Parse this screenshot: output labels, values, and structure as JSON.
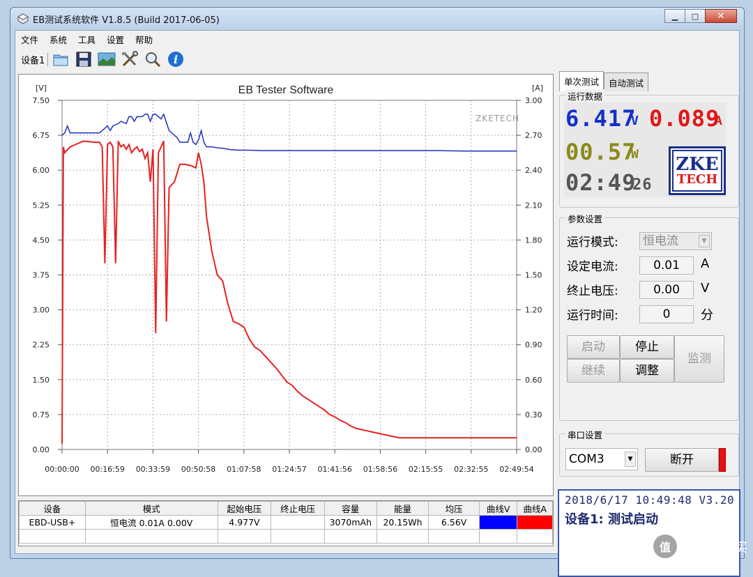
{
  "window": {
    "title": "EB测试系统软件 V1.8.5 (Build 2017-06-05)",
    "controls": {
      "minimize": "▁",
      "maximize": "□",
      "close": "✕"
    }
  },
  "menu": [
    "文件",
    "系统",
    "工具",
    "设置",
    "帮助"
  ],
  "toolbar": {
    "device": "设备1",
    "icons": [
      "folder-open-icon",
      "save-icon",
      "chart-image-icon",
      "tools-icon",
      "search-icon",
      "info-icon"
    ],
    "info_glyph": "i"
  },
  "chart": {
    "title": "EB Tester Software",
    "watermark": "ZKETECH",
    "left_unit": "[V]",
    "right_unit": "[A]"
  },
  "chart_data": {
    "type": "line",
    "title": "EB Tester Software",
    "x_ticks": [
      "00:00:00",
      "00:16:59",
      "00:33:59",
      "00:50:58",
      "01:07:58",
      "01:24:57",
      "01:41:56",
      "01:58:56",
      "02:15:55",
      "02:32:55",
      "02:49:54"
    ],
    "x_range_seconds": [
      0,
      10194
    ],
    "y_left": {
      "label": "[V]",
      "range": [
        0,
        7.5
      ],
      "ticks": [
        "7.50",
        "6.75",
        "6.00",
        "5.25",
        "4.50",
        "3.75",
        "3.00",
        "2.25",
        "1.50",
        "0.75",
        "0.00"
      ]
    },
    "y_right": {
      "label": "[A]",
      "range": [
        0,
        3.0
      ],
      "ticks": [
        "3.00",
        "2.70",
        "2.40",
        "2.10",
        "1.80",
        "1.50",
        "1.20",
        "0.90",
        "0.60",
        "0.30",
        "0.00"
      ]
    },
    "grid": true,
    "series": [
      {
        "color": "#1f2fbf",
        "axis": "left",
        "x_minutes": [
          0,
          1,
          2,
          3,
          8,
          14,
          17,
          18,
          19,
          21,
          22,
          24,
          25,
          26,
          27,
          28,
          30,
          31,
          32,
          33,
          34,
          35,
          37,
          38,
          40,
          43,
          44,
          45,
          46,
          47,
          48,
          49,
          50,
          51,
          52,
          53,
          54,
          56,
          58,
          60,
          63,
          66,
          70,
          75,
          80,
          90,
          100,
          110,
          120,
          130,
          140,
          150,
          160,
          170
        ],
        "values": [
          6.75,
          6.8,
          6.95,
          6.8,
          6.8,
          6.8,
          6.95,
          6.85,
          6.95,
          7.0,
          7.05,
          7.0,
          7.15,
          7.15,
          7.05,
          7.15,
          7.15,
          7.2,
          7.2,
          7.05,
          7.2,
          7.2,
          7.1,
          7.2,
          6.85,
          6.7,
          6.6,
          6.6,
          6.6,
          6.6,
          6.8,
          6.6,
          6.55,
          6.65,
          6.85,
          6.6,
          6.5,
          6.5,
          6.48,
          6.47,
          6.44,
          6.43,
          6.43,
          6.42,
          6.42,
          6.42,
          6.42,
          6.42,
          6.42,
          6.42,
          6.42,
          6.41,
          6.41,
          6.41
        ]
      },
      {
        "color": "#e82020",
        "axis": "right",
        "x_minutes": [
          0,
          0.5,
          1,
          3,
          5,
          8,
          12,
          14,
          15,
          16,
          17,
          18,
          19,
          20,
          21,
          22,
          23,
          24,
          25,
          26,
          27,
          28,
          29,
          30,
          31,
          32,
          33,
          34,
          35,
          36,
          37,
          38,
          39,
          40,
          42,
          44,
          46,
          48,
          50,
          51,
          52,
          53,
          54,
          56,
          58,
          60,
          62,
          64,
          66,
          68,
          70,
          72,
          74,
          76,
          78,
          80,
          82,
          84,
          86,
          88,
          90,
          92,
          94,
          96,
          98,
          100,
          102,
          104,
          106,
          108,
          110,
          112,
          114,
          116,
          118,
          120,
          122,
          124,
          126,
          128,
          130,
          135,
          140,
          145,
          150,
          155,
          160,
          165,
          170
        ],
        "values": [
          0.05,
          2.6,
          2.55,
          2.6,
          2.62,
          2.65,
          2.64,
          2.64,
          2.6,
          1.6,
          2.62,
          2.64,
          2.6,
          1.6,
          2.65,
          2.6,
          2.62,
          2.58,
          2.62,
          2.55,
          2.58,
          2.6,
          2.56,
          2.58,
          2.5,
          2.55,
          2.3,
          2.58,
          1.0,
          2.55,
          2.6,
          2.65,
          1.1,
          2.25,
          2.3,
          2.45,
          2.45,
          2.44,
          2.42,
          2.55,
          2.45,
          2.3,
          2.0,
          1.7,
          1.5,
          1.45,
          1.25,
          1.1,
          1.08,
          1.05,
          0.95,
          0.88,
          0.85,
          0.8,
          0.75,
          0.7,
          0.64,
          0.58,
          0.55,
          0.5,
          0.46,
          0.43,
          0.4,
          0.37,
          0.34,
          0.3,
          0.28,
          0.25,
          0.23,
          0.2,
          0.18,
          0.17,
          0.16,
          0.15,
          0.14,
          0.13,
          0.12,
          0.11,
          0.1,
          0.1,
          0.1,
          0.1,
          0.1,
          0.1,
          0.1,
          0.1,
          0.1,
          0.1,
          0.1
        ]
      }
    ]
  },
  "table": {
    "headers": [
      "设备",
      "模式",
      "起始电压",
      "终止电压",
      "容量",
      "能量",
      "均压",
      "曲线V",
      "曲线A"
    ],
    "rows": [
      {
        "device": "EBD-USB+",
        "mode": "恒电流  0.01A  0.00V",
        "start_v": "4.977V",
        "end_v": "",
        "capacity": "3070mAh",
        "energy": "20.15Wh",
        "avg_v": "6.56V",
        "curve_v_color": "#0000ff",
        "curve_a_color": "#ff0000"
      }
    ]
  },
  "right_panel": {
    "tabs": [
      "单次测试",
      "自动测试"
    ],
    "run_data": {
      "group_title": "运行数据",
      "voltage": "6.417",
      "voltage_unit": "V",
      "current": "0.089",
      "current_unit": "A",
      "power": "00.57",
      "power_unit": "W",
      "time_hm": "02:49",
      "time_s": "26",
      "logo_top": "ZKE",
      "logo_bottom": "TECH"
    },
    "params": {
      "group_title": "参数设置",
      "mode_label": "运行模式:",
      "mode_value": "恒电流",
      "current_label": "设定电流:",
      "current_value": "0.01",
      "current_unit": "A",
      "cutoff_label": "终止电压:",
      "cutoff_value": "0.00",
      "cutoff_unit": "V",
      "time_label": "运行时间:",
      "time_value": "0",
      "time_unit": "分"
    },
    "buttons": {
      "start": "启动",
      "stop": "停止",
      "resume": "继续",
      "adjust": "调整",
      "monitor": "监测"
    },
    "serial": {
      "group_title": "串口设置",
      "port": "COM3",
      "disconnect": "断开"
    },
    "status": {
      "line1": "2018/6/17 10:49:48  V3.20",
      "line2": "设备1: 测试启动"
    }
  },
  "watermark": {
    "badge": "值",
    "text": "什么值得买"
  }
}
